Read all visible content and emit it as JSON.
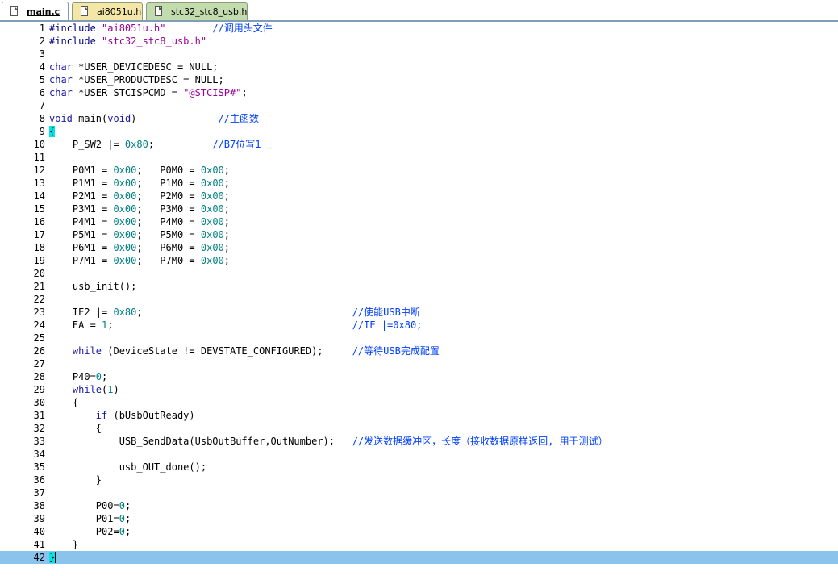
{
  "tabs": [
    {
      "label": "main.c",
      "active": true
    },
    {
      "label": "ai8051u.h",
      "active": false
    },
    {
      "label": "stc32_stc8_usb.h",
      "active": false
    }
  ],
  "editor": {
    "current_line": 42,
    "lines": [
      {
        "n": "1",
        "t": [
          [
            "pp",
            "#include "
          ],
          [
            "str",
            "\"ai8051u.h\""
          ],
          [
            "",
            "        "
          ],
          [
            "cmt",
            "//调用头文件"
          ]
        ]
      },
      {
        "n": "2",
        "t": [
          [
            "pp",
            "#include "
          ],
          [
            "str",
            "\"stc32_stc8_usb.h\""
          ]
        ]
      },
      {
        "n": "3",
        "t": []
      },
      {
        "n": "4",
        "t": [
          [
            "kw",
            "char"
          ],
          [
            "",
            " *USER_DEVICEDESC = NULL;"
          ]
        ]
      },
      {
        "n": "5",
        "t": [
          [
            "kw",
            "char"
          ],
          [
            "",
            " *USER_PRODUCTDESC = NULL;"
          ]
        ]
      },
      {
        "n": "6",
        "t": [
          [
            "kw",
            "char"
          ],
          [
            "",
            " *USER_STCISPCMD = "
          ],
          [
            "str",
            "\"@STCISP#\""
          ],
          [
            "",
            ";"
          ]
        ]
      },
      {
        "n": "7",
        "t": []
      },
      {
        "n": "8",
        "t": [
          [
            "kw",
            "void"
          ],
          [
            "",
            " main("
          ],
          [
            "kw",
            "void"
          ],
          [
            "",
            ")              "
          ],
          [
            "cmt",
            "//主函数"
          ]
        ]
      },
      {
        "n": "9",
        "t": [
          [
            "brace",
            "{"
          ]
        ]
      },
      {
        "n": "10",
        "t": [
          [
            "",
            "    P_SW2 |= "
          ],
          [
            "num",
            "0x80"
          ],
          [
            "",
            ";          "
          ],
          [
            "cmt",
            "//B7位写1"
          ]
        ]
      },
      {
        "n": "11",
        "t": []
      },
      {
        "n": "12",
        "t": [
          [
            "",
            "    P0M1 = "
          ],
          [
            "num",
            "0x00"
          ],
          [
            "",
            ";   P0M0 = "
          ],
          [
            "num",
            "0x00"
          ],
          [
            "",
            ";"
          ]
        ]
      },
      {
        "n": "13",
        "t": [
          [
            "",
            "    P1M1 = "
          ],
          [
            "num",
            "0x00"
          ],
          [
            "",
            ";   P1M0 = "
          ],
          [
            "num",
            "0x00"
          ],
          [
            "",
            ";"
          ]
        ]
      },
      {
        "n": "14",
        "t": [
          [
            "",
            "    P2M1 = "
          ],
          [
            "num",
            "0x00"
          ],
          [
            "",
            ";   P2M0 = "
          ],
          [
            "num",
            "0x00"
          ],
          [
            "",
            ";"
          ]
        ]
      },
      {
        "n": "15",
        "t": [
          [
            "",
            "    P3M1 = "
          ],
          [
            "num",
            "0x00"
          ],
          [
            "",
            ";   P3M0 = "
          ],
          [
            "num",
            "0x00"
          ],
          [
            "",
            ";"
          ]
        ]
      },
      {
        "n": "16",
        "t": [
          [
            "",
            "    P4M1 = "
          ],
          [
            "num",
            "0x00"
          ],
          [
            "",
            ";   P4M0 = "
          ],
          [
            "num",
            "0x00"
          ],
          [
            "",
            ";"
          ]
        ]
      },
      {
        "n": "17",
        "t": [
          [
            "",
            "    P5M1 = "
          ],
          [
            "num",
            "0x00"
          ],
          [
            "",
            ";   P5M0 = "
          ],
          [
            "num",
            "0x00"
          ],
          [
            "",
            ";"
          ]
        ]
      },
      {
        "n": "18",
        "t": [
          [
            "",
            "    P6M1 = "
          ],
          [
            "num",
            "0x00"
          ],
          [
            "",
            ";   P6M0 = "
          ],
          [
            "num",
            "0x00"
          ],
          [
            "",
            ";"
          ]
        ]
      },
      {
        "n": "19",
        "t": [
          [
            "",
            "    P7M1 = "
          ],
          [
            "num",
            "0x00"
          ],
          [
            "",
            ";   P7M0 = "
          ],
          [
            "num",
            "0x00"
          ],
          [
            "",
            ";"
          ]
        ]
      },
      {
        "n": "20",
        "t": []
      },
      {
        "n": "21",
        "t": [
          [
            "",
            "    usb_init();"
          ]
        ]
      },
      {
        "n": "22",
        "t": []
      },
      {
        "n": "23",
        "t": [
          [
            "",
            "    IE2 |= "
          ],
          [
            "num",
            "0x80"
          ],
          [
            "",
            ";                                    "
          ],
          [
            "cmt",
            "//使能USB中断"
          ]
        ]
      },
      {
        "n": "24",
        "t": [
          [
            "",
            "    EA = "
          ],
          [
            "num",
            "1"
          ],
          [
            "",
            ";                                         "
          ],
          [
            "cmt",
            "//IE |=0x80;"
          ]
        ]
      },
      {
        "n": "25",
        "t": []
      },
      {
        "n": "26",
        "t": [
          [
            "",
            "    "
          ],
          [
            "kw",
            "while"
          ],
          [
            "",
            " (DeviceState != DEVSTATE_CONFIGURED);     "
          ],
          [
            "cmt",
            "//等待USB完成配置"
          ]
        ]
      },
      {
        "n": "27",
        "t": []
      },
      {
        "n": "28",
        "t": [
          [
            "",
            "    P40="
          ],
          [
            "num",
            "0"
          ],
          [
            "",
            ";"
          ]
        ]
      },
      {
        "n": "29",
        "t": [
          [
            "",
            "    "
          ],
          [
            "kw",
            "while"
          ],
          [
            "",
            "("
          ],
          [
            "num",
            "1"
          ],
          [
            "",
            ")"
          ]
        ]
      },
      {
        "n": "30",
        "t": [
          [
            "",
            "    {"
          ]
        ]
      },
      {
        "n": "31",
        "t": [
          [
            "",
            "        "
          ],
          [
            "kw",
            "if"
          ],
          [
            "",
            " (bUsbOutReady)"
          ]
        ]
      },
      {
        "n": "32",
        "t": [
          [
            "",
            "        {"
          ]
        ]
      },
      {
        "n": "33",
        "t": [
          [
            "",
            "            USB_SendData(UsbOutBuffer,OutNumber);   "
          ],
          [
            "cmt",
            "//发送数据缓冲区，长度（接收数据原样返回, 用于测试）"
          ]
        ]
      },
      {
        "n": "34",
        "t": []
      },
      {
        "n": "35",
        "t": [
          [
            "",
            "            usb_OUT_done();"
          ]
        ]
      },
      {
        "n": "36",
        "t": [
          [
            "",
            "        }"
          ]
        ]
      },
      {
        "n": "37",
        "t": []
      },
      {
        "n": "38",
        "t": [
          [
            "",
            "        P00="
          ],
          [
            "num",
            "0"
          ],
          [
            "",
            ";"
          ]
        ]
      },
      {
        "n": "39",
        "t": [
          [
            "",
            "        P01="
          ],
          [
            "num",
            "0"
          ],
          [
            "",
            ";"
          ]
        ]
      },
      {
        "n": "40",
        "t": [
          [
            "",
            "        P02="
          ],
          [
            "num",
            "0"
          ],
          [
            "",
            ";"
          ]
        ]
      },
      {
        "n": "41",
        "t": [
          [
            "",
            "    }"
          ]
        ]
      },
      {
        "n": "42",
        "t": [
          [
            "brace",
            "}"
          ]
        ]
      }
    ]
  }
}
